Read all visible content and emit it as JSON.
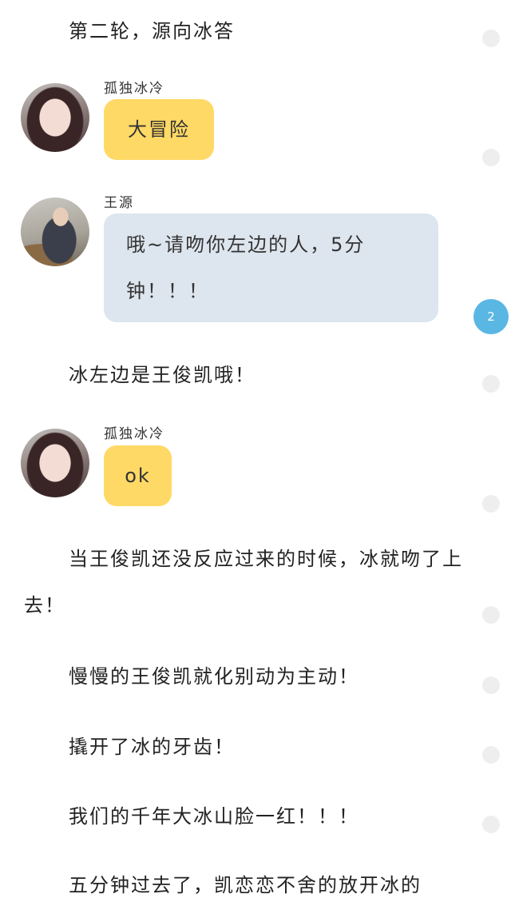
{
  "story": {
    "p1": "第二轮，源向冰答",
    "p2": "冰左边是王俊凯哦！",
    "p3": "当王俊凯还没反应过来的时候，冰就吻了上去！",
    "p4": "慢慢的王俊凯就化别动为主动！",
    "p5": "撬开了冰的牙齿！",
    "p6": "我们的千年大冰山脸一红！！！",
    "p7": "五分钟过去了，凯恋恋不舍的放开冰的"
  },
  "chat": [
    {
      "name": "孤独冰冷",
      "text": "大冒险"
    },
    {
      "name": "王源",
      "line1": "哦~请吻你左边的人，5分",
      "line2": "钟！！！"
    },
    {
      "name": "孤独冰冷",
      "text": "ok"
    }
  ],
  "comment_badge": "2",
  "colors": {
    "yellow_bubble": "#ffd966",
    "blue_bubble": "#dde5ee",
    "badge": "#5ab7e3"
  }
}
